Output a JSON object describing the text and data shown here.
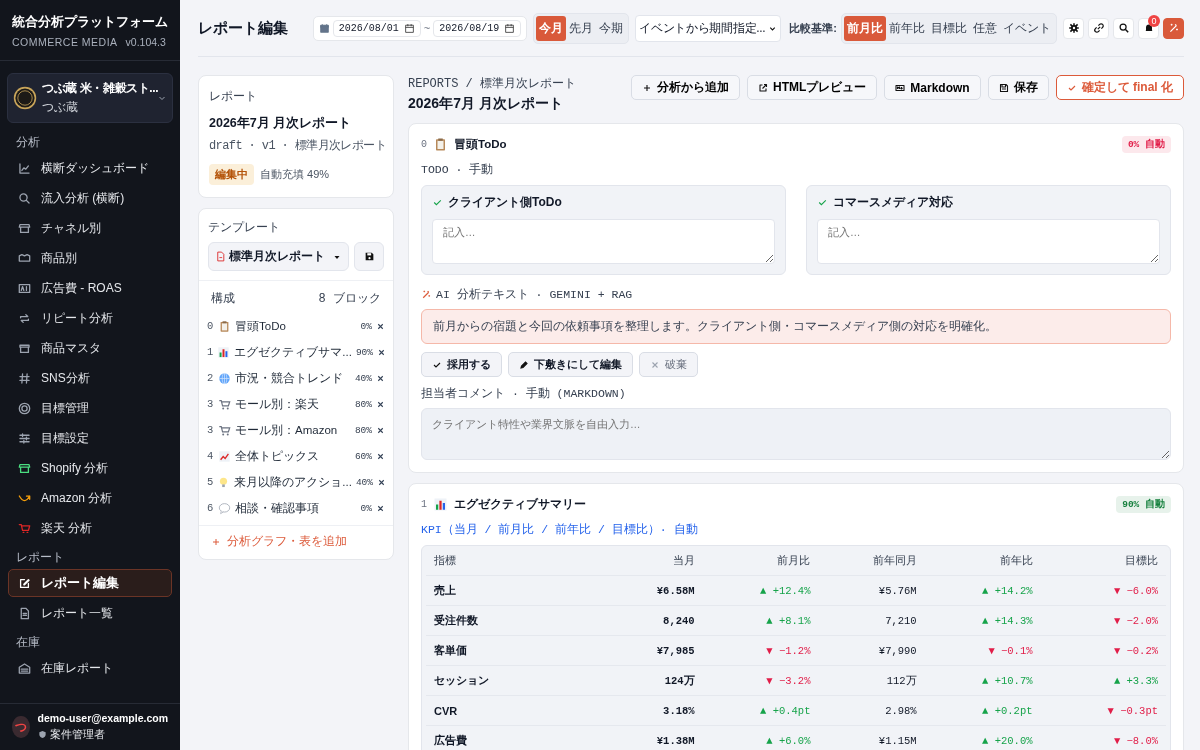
{
  "sidebar": {
    "title": "統合分析プラットフォーム",
    "subtitle": "COMMERCE MEDIA",
    "version": "v0.104.3",
    "store": {
      "name": "つぶ蔵 米・雑穀スト...",
      "sub": "つぶ蔵"
    },
    "sections": [
      {
        "label": "分析",
        "items": [
          {
            "label": "横断ダッシュボード",
            "selected": false
          },
          {
            "label": "流入分析 (横断)",
            "selected": false
          },
          {
            "label": "チャネル別",
            "selected": false
          },
          {
            "label": "商品別",
            "selected": false
          },
          {
            "label": "広告費 - ROAS",
            "selected": false
          },
          {
            "label": "リピート分析",
            "selected": false
          },
          {
            "label": "商品マスタ",
            "selected": false
          },
          {
            "label": "SNS分析",
            "selected": false
          },
          {
            "label": "目標管理",
            "selected": false
          },
          {
            "label": "目標設定",
            "selected": false
          },
          {
            "label": "Shopify 分析",
            "selected": false
          },
          {
            "label": "Amazon 分析",
            "selected": false
          },
          {
            "label": "楽天 分析",
            "selected": false
          }
        ]
      },
      {
        "label": "レポート",
        "items": [
          {
            "label": "レポート編集",
            "selected": true
          },
          {
            "label": "レポート一覧",
            "selected": false
          }
        ]
      },
      {
        "label": "在庫",
        "items": [
          {
            "label": "在庫レポート",
            "selected": false
          }
        ]
      }
    ],
    "user": {
      "avatar": "つ",
      "email": "demo-user@example.com",
      "role": "案件管理者"
    }
  },
  "header": {
    "title": "レポート編集",
    "date_from": "2026/08/01",
    "date_sep": "~",
    "date_to": "2026/08/19",
    "periods": [
      {
        "label": "今月",
        "selected": true
      },
      {
        "label": "先月",
        "selected": false
      },
      {
        "label": "今期",
        "selected": false
      }
    ],
    "event_select": "イベントから期間指定...",
    "compare_label": "比較基準:",
    "compare": [
      {
        "label": "前月比",
        "selected": true
      },
      {
        "label": "前年比",
        "selected": false
      },
      {
        "label": "目標比",
        "selected": false
      },
      {
        "label": "任意",
        "selected": false
      },
      {
        "label": "イベント",
        "selected": false
      }
    ],
    "notifications": "0"
  },
  "report": {
    "label": "レポート",
    "title": "2026年7月 月次レポート",
    "meta": "draft · v1 · 標準月次レポート",
    "status": "編集中",
    "autofill": "自動充填 49%"
  },
  "template": {
    "label": "テンプレート",
    "select": "標準月次レポート",
    "structure_label": "構成",
    "count": "8 ブロック",
    "blocks": [
      {
        "num": "0",
        "name": "冒頭ToDo",
        "pct": "0%"
      },
      {
        "num": "1",
        "name": "エグゼクティブサマ...",
        "pct": "90%"
      },
      {
        "num": "2",
        "name": "市況・競合トレンド",
        "pct": "40%"
      },
      {
        "num": "3",
        "name": "モール別：楽天",
        "pct": "80%"
      },
      {
        "num": "3",
        "name": "モール別：Amazon",
        "pct": "80%"
      },
      {
        "num": "4",
        "name": "全体トピックス",
        "pct": "60%"
      },
      {
        "num": "5",
        "name": "来月以降のアクショ...",
        "pct": "40%"
      },
      {
        "num": "6",
        "name": "相談・確認事項",
        "pct": "0%"
      }
    ],
    "add": "分析グラフ・表を追加"
  },
  "editor": {
    "breadcrumb": "REPORTS / 標準月次レポート",
    "title": "2026年7月 月次レポート",
    "buttons": [
      {
        "label": "分析から追加",
        "kind": "add"
      },
      {
        "label": "HTMLプレビュー",
        "kind": "preview"
      },
      {
        "label": "Markdown",
        "kind": "markdown"
      },
      {
        "label": "保存",
        "kind": "save"
      },
      {
        "label": "確定して final 化",
        "kind": "finalize"
      }
    ],
    "todo_block": {
      "num": "0",
      "title": "冒頭ToDo",
      "badge": "0% 自動",
      "color": "#e11d48",
      "meta": "TODO · 手動",
      "panels": [
        {
          "title": "クライアント側ToDo",
          "placeholder": "記入…"
        },
        {
          "title": "コマースメディア対応",
          "placeholder": "記入…"
        }
      ],
      "ai_label": "AI 分析テキスト · GEMINI + RAG",
      "ai_text": "前月からの宿題と今回の依頼事項を整理します。クライアント側・コマースメディア側の対応を明確化。",
      "actions": [
        {
          "label": "採用する",
          "kind": "adopt",
          "disabled": false
        },
        {
          "label": "下敷きにして編集",
          "kind": "edit",
          "disabled": false
        },
        {
          "label": "破棄",
          "kind": "discard",
          "disabled": true
        }
      ],
      "comment_label": "担当者コメント · 手動 (MARKDOWN)",
      "comment_placeholder": "クライアント特性や業界文脈を自由入力…"
    },
    "kpi_block": {
      "num": "1",
      "title": "エグゼクティブサマリー",
      "badge": "90% 自動",
      "color": "#15803d",
      "meta": "KPI（当月 / 前月比 / 前年比 / 目標比）· 自動",
      "columns": [
        "指標",
        "当月",
        "前月比",
        "前年同月",
        "前年比",
        "目標比"
      ],
      "rows": [
        {
          "metric": "売上",
          "current": "¥6.58M",
          "mom": {
            "text": "▲ +12.4%",
            "color": "#16a34a"
          },
          "prev_year": "¥5.76M",
          "yoy": {
            "text": "▲ +14.2%",
            "color": "#16a34a"
          },
          "target": {
            "text": "▼ −6.0%",
            "color": "#e11d48"
          }
        },
        {
          "metric": "受注件数",
          "current": "8,240",
          "mom": {
            "text": "▲ +8.1%",
            "color": "#16a34a"
          },
          "prev_year": "7,210",
          "yoy": {
            "text": "▲ +14.3%",
            "color": "#16a34a"
          },
          "target": {
            "text": "▼ −2.0%",
            "color": "#e11d48"
          }
        },
        {
          "metric": "客単価",
          "current": "¥7,985",
          "mom": {
            "text": "▼ −1.2%",
            "color": "#e11d48"
          },
          "prev_year": "¥7,990",
          "yoy": {
            "text": "▼ −0.1%",
            "color": "#e11d48"
          },
          "target": {
            "text": "▼ −0.2%",
            "color": "#e11d48"
          }
        },
        {
          "metric": "セッション",
          "current": "124万",
          "mom": {
            "text": "▼ −3.2%",
            "color": "#e11d48"
          },
          "prev_year": "112万",
          "yoy": {
            "text": "▲ +10.7%",
            "color": "#16a34a"
          },
          "target": {
            "text": "▲ +3.3%",
            "color": "#16a34a"
          }
        },
        {
          "metric": "CVR",
          "current": "3.18%",
          "mom": {
            "text": "▲ +0.4pt",
            "color": "#16a34a"
          },
          "prev_year": "2.98%",
          "yoy": {
            "text": "▲ +0.2pt",
            "color": "#16a34a"
          },
          "target": {
            "text": "▼ −0.3pt",
            "color": "#e11d48"
          }
        },
        {
          "metric": "広告費",
          "current": "¥1.38M",
          "mom": {
            "text": "▲ +6.0%",
            "color": "#16a34a"
          },
          "prev_year": "¥1.15M",
          "yoy": {
            "text": "▲ +20.0%",
            "color": "#16a34a"
          },
          "target": {
            "text": "▼ −8.0%",
            "color": "#e11d48"
          }
        }
      ]
    }
  }
}
